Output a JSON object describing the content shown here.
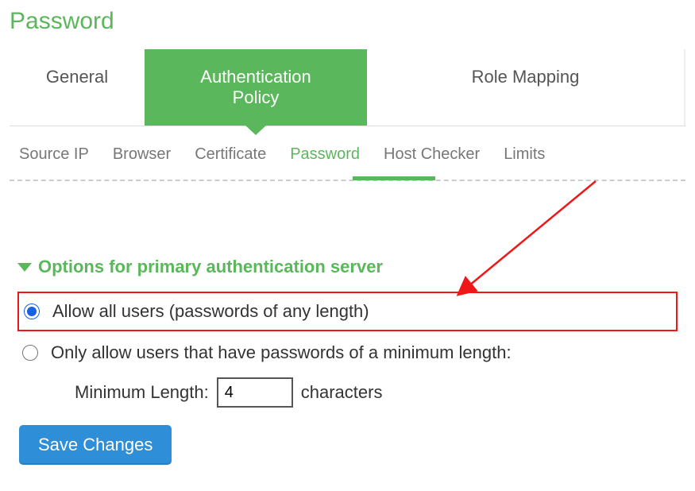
{
  "page_title": "Password",
  "tabs": {
    "general": "General",
    "policy": "Authentication Policy",
    "role": "Role Mapping"
  },
  "subtabs": {
    "source_ip": "Source IP",
    "browser": "Browser",
    "certificate": "Certificate",
    "password": "Password",
    "host_checker": "Host Checker",
    "limits": "Limits"
  },
  "section": {
    "header": "Options for primary authentication server",
    "opt_allow_all": "Allow all users (passwords of any length)",
    "opt_min_length": "Only allow users that have passwords of a minimum length:",
    "min_label": "Minimum Length:",
    "min_value": "4",
    "min_suffix": "characters"
  },
  "save_button": "Save Changes"
}
